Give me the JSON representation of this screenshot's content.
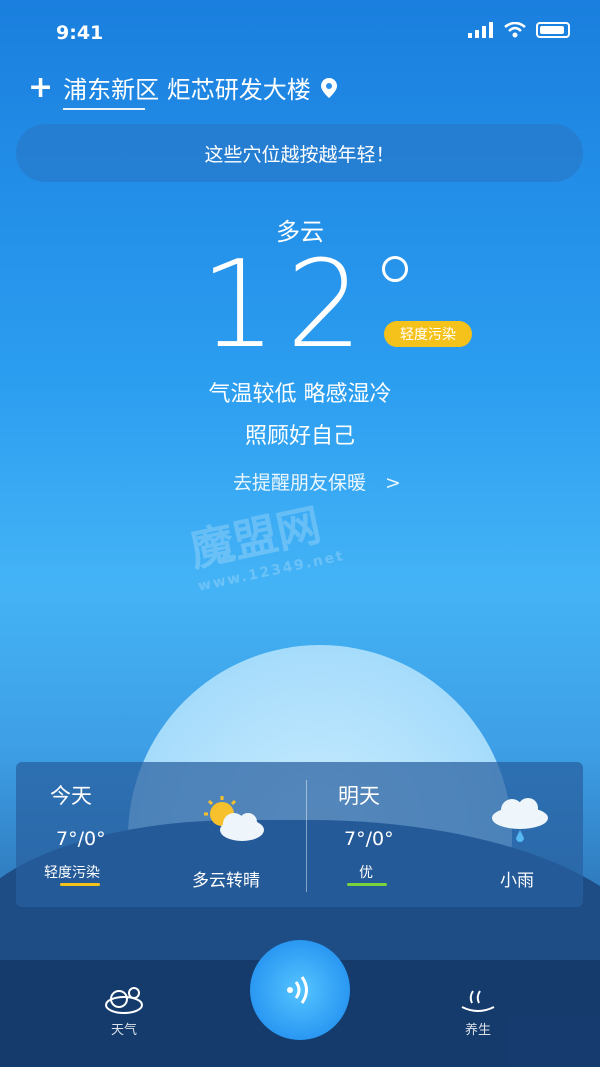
{
  "status_bar": {
    "time": "9:41"
  },
  "header": {
    "plus": "+",
    "location": "浦东新区 炬芯研发大楼"
  },
  "banner": {
    "text": "这些穴位越按越年轻！"
  },
  "current": {
    "condition": "多云",
    "temperature": "12",
    "aqi_label": "轻度污染",
    "tip_line1": "气温较低 略感湿冷",
    "tip_line2": "照顾好自己",
    "remind": "去提醒朋友保暖　>"
  },
  "forecast": {
    "today": {
      "title": "今天",
      "temp": "7°/0°",
      "aqi": "轻度污染",
      "aqi_color": "#f5c21b",
      "desc": "多云转晴",
      "icon": "partly-sunny-icon"
    },
    "tomorrow": {
      "title": "明天",
      "temp": "7°/0°",
      "aqi": "优",
      "aqi_color": "#7bd33c",
      "desc": "小雨",
      "icon": "light-rain-icon"
    }
  },
  "nav": {
    "weather_label": "天气",
    "health_label": "养生"
  },
  "watermark": {
    "brand": "魔盟网",
    "site": "www.12349.net"
  }
}
